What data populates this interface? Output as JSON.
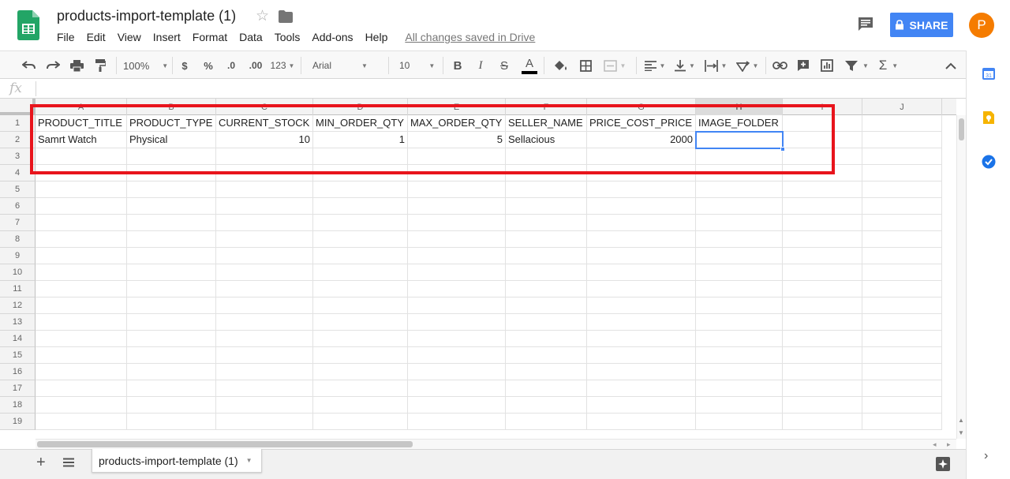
{
  "app": {
    "doc_title": "products-import-template (1)",
    "save_status": "All changes saved in Drive",
    "share_label": "SHARE",
    "avatar_initial": "P",
    "accent_color": "#4285f4",
    "highlight_color": "#e8141c",
    "menu": [
      "File",
      "Edit",
      "View",
      "Insert",
      "Format",
      "Data",
      "Tools",
      "Add-ons",
      "Help"
    ]
  },
  "toolbar": {
    "zoom": "100%",
    "currency": "$",
    "percent": "%",
    "decrease_decimal": ".0",
    "increase_decimal": ".00",
    "more_formats": "123",
    "font": "Arial",
    "font_size": "10",
    "bold": "B",
    "italic": "I",
    "strike": "S",
    "text_color": "A",
    "sigma": "Σ"
  },
  "formula_bar": {
    "fx": "fx",
    "value": ""
  },
  "columns": [
    "A",
    "B",
    "C",
    "D",
    "E",
    "F",
    "G",
    "H",
    "I",
    "J"
  ],
  "rows": [
    "1",
    "2",
    "3",
    "4",
    "5",
    "6",
    "7",
    "8",
    "9",
    "10",
    "11",
    "12",
    "13",
    "14",
    "15",
    "16",
    "17",
    "18",
    "19"
  ],
  "cells": {
    "row1": [
      "PRODUCT_TITLE",
      "PRODUCT_TYPE",
      "CURRENT_STOCK",
      "MIN_ORDER_QTY",
      "MAX_ORDER_QTY",
      "SELLER_NAME",
      "PRICE_COST_PRICE",
      "IMAGE_FOLDER"
    ],
    "row2": [
      "Samrt Watch",
      "Physical",
      "10",
      "1",
      "5",
      "Sellacious",
      "2000",
      ""
    ]
  },
  "selected_cell": "H2",
  "sheet_tab": {
    "label": "products-import-template (1)"
  }
}
